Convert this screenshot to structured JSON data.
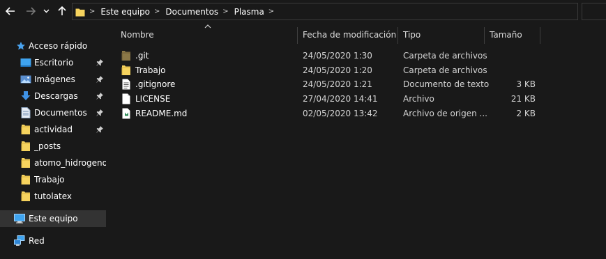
{
  "breadcrumb": {
    "items": [
      "Este equipo",
      "Documentos",
      "Plasma"
    ]
  },
  "sidebar": {
    "items": [
      {
        "label": "Acceso rápido",
        "icon": "star-icon",
        "pinned": false
      },
      {
        "label": "Escritorio",
        "icon": "desktop-icon",
        "pinned": true
      },
      {
        "label": "Imágenes",
        "icon": "pictures-icon",
        "pinned": true
      },
      {
        "label": "Descargas",
        "icon": "downloads-icon",
        "pinned": true
      },
      {
        "label": "Documentos",
        "icon": "documents-icon",
        "pinned": true
      },
      {
        "label": "actividad",
        "icon": "folder-icon",
        "pinned": true
      },
      {
        "label": "_posts",
        "icon": "folder-icon",
        "pinned": false
      },
      {
        "label": "atomo_hidrogenoide",
        "icon": "folder-icon",
        "pinned": false
      },
      {
        "label": "Trabajo",
        "icon": "folder-icon",
        "pinned": false
      },
      {
        "label": "tutolatex",
        "icon": "folder-icon",
        "pinned": false
      },
      {
        "label": "Este equipo",
        "icon": "this-pc-icon",
        "pinned": false,
        "selected": true
      },
      {
        "label": "Red",
        "icon": "network-icon",
        "pinned": false
      }
    ]
  },
  "columns": {
    "name": "Nombre",
    "modified": "Fecha de modificación",
    "type": "Tipo",
    "size": "Tamaño"
  },
  "files": [
    {
      "name": ".git",
      "modified": "24/05/2020 1:30",
      "type": "Carpeta de archivos",
      "size": "",
      "icon": "hidden-folder-icon"
    },
    {
      "name": "Trabajo",
      "modified": "24/05/2020 1:20",
      "type": "Carpeta de archivos",
      "size": "",
      "icon": "folder-icon"
    },
    {
      "name": ".gitignore",
      "modified": "24/05/2020 1:21",
      "type": "Documento de texto",
      "size": "3 KB",
      "icon": "text-file-icon"
    },
    {
      "name": "LICENSE",
      "modified": "27/04/2020 14:41",
      "type": "Archivo",
      "size": "21 KB",
      "icon": "file-icon"
    },
    {
      "name": "README.md",
      "modified": "02/05/2020 13:42",
      "type": "Archivo de origen ...",
      "size": "2 KB",
      "icon": "markdown-file-icon"
    }
  ],
  "colors": {
    "background": "#191919",
    "folder": "#f6d35e",
    "selected": "#333333",
    "accent": "#4aa3ef"
  }
}
